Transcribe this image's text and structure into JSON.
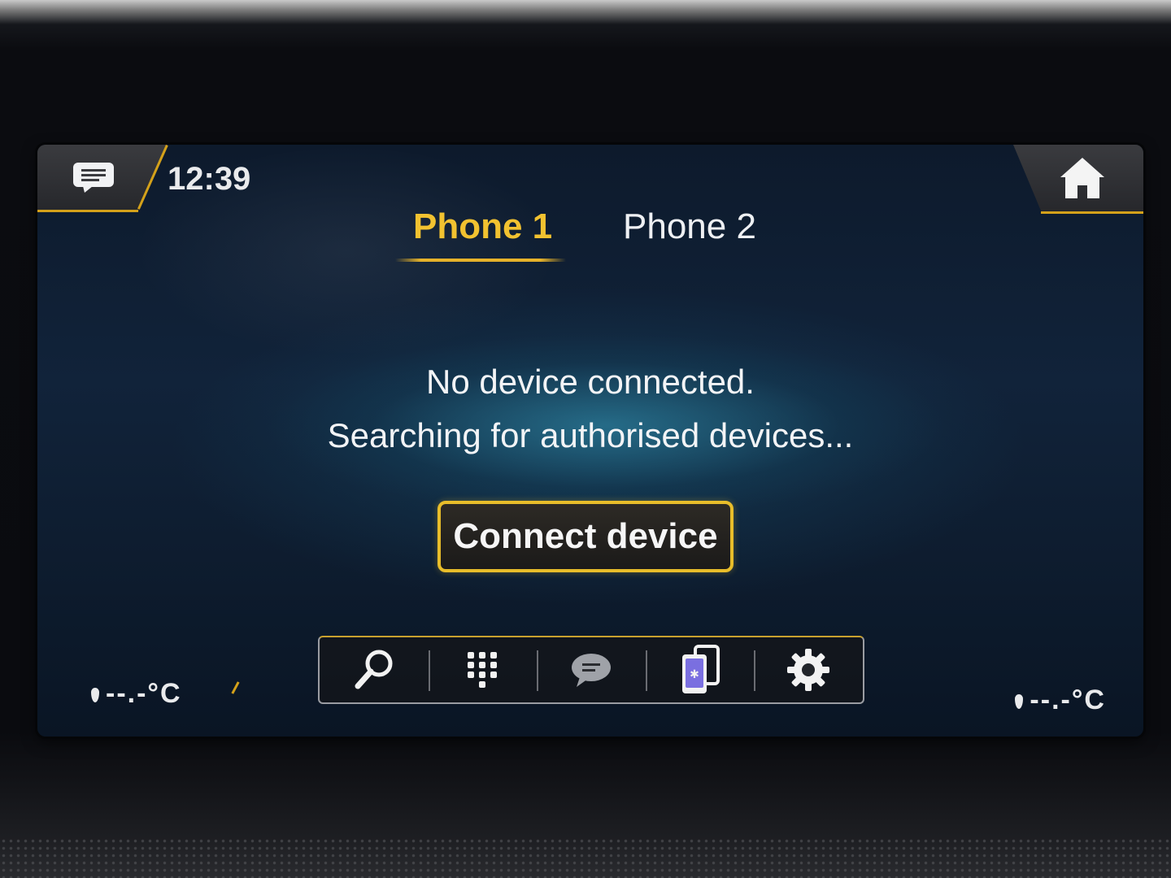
{
  "header": {
    "clock": "12:39"
  },
  "tabs": [
    {
      "label": "Phone 1",
      "active": true
    },
    {
      "label": "Phone 2",
      "active": false
    }
  ],
  "status": {
    "line1": "No device connected.",
    "line2": "Searching for authorised devices..."
  },
  "actions": {
    "connect_label": "Connect device"
  },
  "toolbar": {
    "items": [
      {
        "icon": "search-icon"
      },
      {
        "icon": "dialpad-icon"
      },
      {
        "icon": "messages-icon"
      },
      {
        "icon": "device-manager-icon"
      },
      {
        "icon": "settings-icon"
      }
    ]
  },
  "climate": {
    "left_temp": "--.-°C",
    "right_temp": "--.-°C"
  },
  "colors": {
    "accent": "#e8bd2a",
    "background": "#11233a",
    "text": "#f3f4f6",
    "glow": "#3496b4"
  },
  "icons": {
    "top_left": "message-icon",
    "top_right": "home-icon"
  }
}
